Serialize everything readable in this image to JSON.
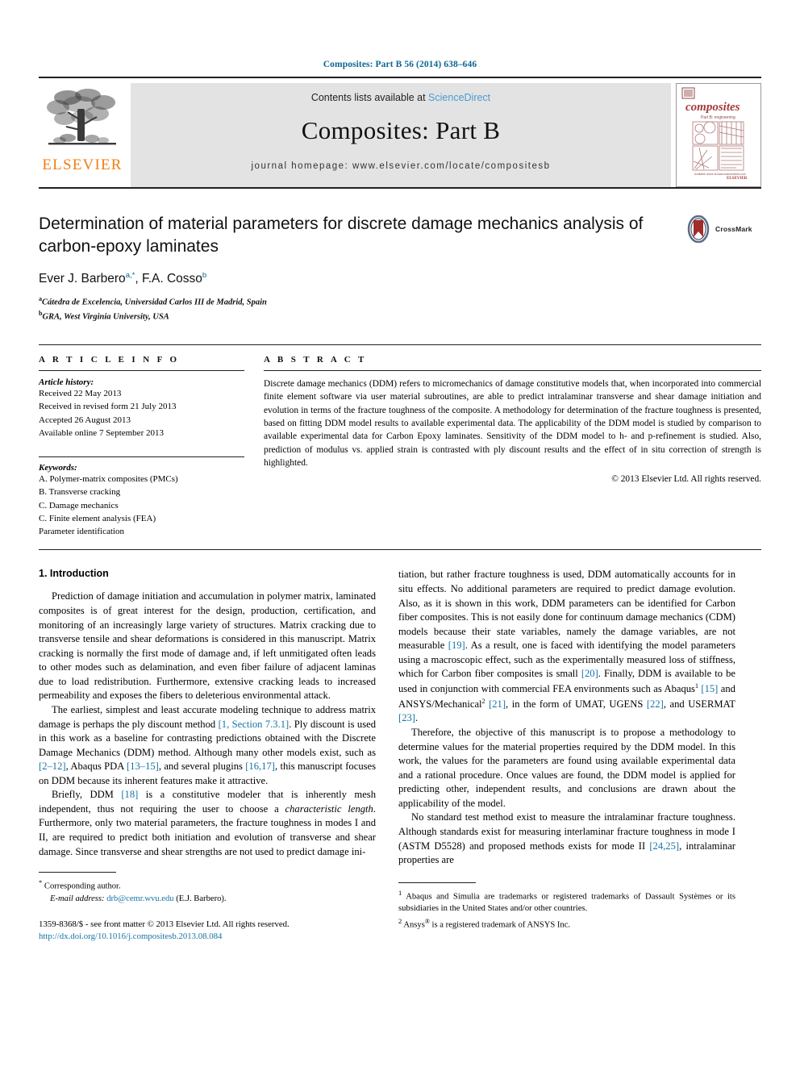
{
  "running_head": "Composites: Part B 56 (2014) 638–646",
  "masthead": {
    "contents_prefix": "Contents lists available at ",
    "sciencedirect": "ScienceDirect",
    "journal_title": "Composites: Part B",
    "homepage": "journal homepage: www.elsevier.com/locate/compositesb",
    "publisher_name": "ELSEVIER",
    "cover": {
      "brand": "composites",
      "subtitle": "Part B: engineering"
    }
  },
  "article": {
    "title": "Determination of material parameters for discrete damage mechanics analysis of carbon-epoxy laminates",
    "authors_plain": "Ever J. Barbero",
    "author1": "Ever J. Barbero",
    "author1_sup": "a,*",
    "author2": "F.A. Cosso",
    "author2_sup": "b",
    "affiliation_a_sup": "a",
    "affiliation_a": "Cátedra de Excelencia, Universidad Carlos III de Madrid, Spain",
    "affiliation_b_sup": "b",
    "affiliation_b": "GRA, West Virginia University, USA",
    "crossmark_label": "CrossMark"
  },
  "info": {
    "heading": "A R T I C L E    I N F O",
    "history_heading": "Article history:",
    "history": [
      "Received 22 May 2013",
      "Received in revised form 21 July 2013",
      "Accepted 26 August 2013",
      "Available online 7 September 2013"
    ],
    "keywords_heading": "Keywords:",
    "keywords": [
      "A. Polymer-matrix composites (PMCs)",
      "B. Transverse cracking",
      "C. Damage mechanics",
      "C. Finite element analysis (FEA)",
      "Parameter identification"
    ]
  },
  "abstract": {
    "heading": "A B S T R A C T",
    "text": "Discrete damage mechanics (DDM) refers to micromechanics of damage constitutive models that, when incorporated into commercial finite element software via user material subroutines, are able to predict intralaminar transverse and shear damage initiation and evolution in terms of the fracture toughness of the composite. A methodology for determination of the fracture toughness is presented, based on fitting DDM model results to available experimental data. The applicability of the DDM model is studied by comparison to available experimental data for Carbon Epoxy laminates. Sensitivity of the DDM model to h- and p-refinement is studied. Also, prediction of modulus vs. applied strain is contrasted with ply discount results and the effect of in situ correction of strength is highlighted.",
    "copyright": "© 2013 Elsevier Ltd. All rights reserved."
  },
  "body": {
    "section_title": "1. Introduction",
    "left_p1": "Prediction of damage initiation and accumulation in polymer matrix, laminated composites is of great interest for the design, production, certification, and monitoring of an increasingly large variety of structures. Matrix cracking due to transverse tensile and shear deformations is considered in this manuscript. Matrix cracking is normally the first mode of damage and, if left unmitigated often leads to other modes such as delamination, and even fiber failure of adjacent laminas due to load redistribution. Furthermore, extensive cracking leads to increased permeability and exposes the fibers to deleterious environmental attack.",
    "left_p2_a": "The earliest, simplest and least accurate modeling technique to address matrix damage is perhaps the ply discount method ",
    "left_p2_ref1": "[1, Section 7.3.1]",
    "left_p2_b": ". Ply discount is used in this work as a baseline for contrasting predictions obtained with the Discrete Damage Mechanics (DDM) method. Although many other models exist, such as ",
    "left_p2_ref2": "[2–12]",
    "left_p2_c": ", Abaqus PDA ",
    "left_p2_ref3": "[13–15]",
    "left_p2_d": ", and several plugins ",
    "left_p2_ref4": "[16,17]",
    "left_p2_e": ", this manuscript focuses on DDM because its inherent features make it attractive.",
    "left_p3_a": "Briefly, DDM ",
    "left_p3_ref1": "[18]",
    "left_p3_b": " is a constitutive modeler that is inherently mesh independent, thus not requiring the user to choose a ",
    "left_p3_ital": "characteristic length",
    "left_p3_c": ". Furthermore, only two material parameters, the fracture toughness in modes I and II, are required to predict both initiation and evolution of transverse and shear damage. Since transverse and shear strengths are not used to predict damage ini-",
    "right_p1_a": "tiation, but rather fracture toughness is used, DDM automatically accounts for in situ effects. No additional parameters are required to predict damage evolution. Also, as it is shown in this work, DDM parameters can be identified for Carbon fiber composites. This is not easily done for continuum damage mechanics (CDM) models because their state variables, namely the damage variables, are not measurable ",
    "right_p1_ref1": "[19]",
    "right_p1_b": ". As a result, one is faced with identifying the model parameters using a macroscopic effect, such as the experimentally measured loss of stiffness, which for Carbon fiber composites is small ",
    "right_p1_ref2": "[20]",
    "right_p1_c": ". Finally, DDM is available to be used in conjunction with commercial FEA environments such as Abaqus",
    "right_p1_sup1": "1",
    "right_p1_ref3": "[15]",
    "right_p1_d": " and ANSYS/Mechanical",
    "right_p1_sup2": "2",
    "right_p1_ref4": "[21]",
    "right_p1_e": ", in the form of UMAT, UGENS ",
    "right_p1_ref5": "[22]",
    "right_p1_f": ", and USERMAT ",
    "right_p1_ref6": "[23]",
    "right_p1_g": ".",
    "right_p2": "Therefore, the objective of this manuscript is to propose a methodology to determine values for the material properties required by the DDM model. In this work, the values for the parameters are found using available experimental data and a rational procedure. Once values are found, the DDM model is applied for predicting other, independent results, and conclusions are drawn about the applicability of the model.",
    "right_p3_a": "No standard test method exist to measure the intralaminar fracture toughness. Although standards exist for measuring interlaminar fracture toughness in mode I (ASTM D5528) and proposed methods exists for mode II ",
    "right_p3_ref1": "[24,25]",
    "right_p3_b": ", intralaminar properties are"
  },
  "footnotes": {
    "corresponding_mark": "*",
    "corresponding": "Corresponding author.",
    "email_label": "E-mail address:",
    "email": "drb@cemr.wvu.edu",
    "email_owner": "(E.J. Barbero).",
    "fn1_mark": "1",
    "fn1": "Abaqus and Simulia are trademarks or registered trademarks of Dassault Systèmes or its subsidiaries in the United States and/or other countries.",
    "fn2_mark": "2",
    "fn2_pre": "Ansys",
    "fn2_sup": "®",
    "fn2_post": " is a registered trademark of ANSYS Inc.",
    "issn_line": "1359-8368/$ - see front matter © 2013 Elsevier Ltd. All rights reserved.",
    "doi": "http://dx.doi.org/10.1016/j.compositesb.2013.08.084"
  },
  "colors": {
    "link": "#1573a6",
    "running_head": "#0b6695",
    "elsevier_orange": "#f07f13",
    "sciencedirect": "#4a9ad4",
    "band_gray": "#e3e3e3"
  }
}
